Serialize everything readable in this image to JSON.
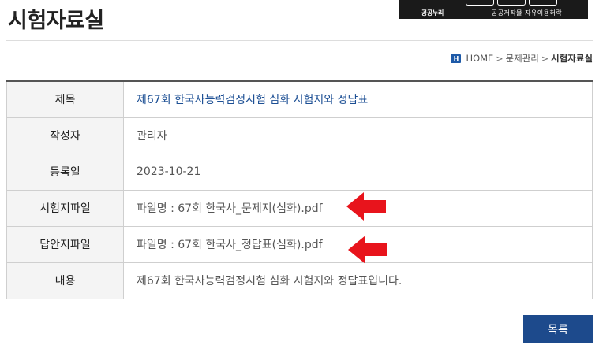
{
  "page": {
    "title": "시험자료실"
  },
  "license": {
    "left_label": "공공누리",
    "right_label": "공공저작물 자유이용허락"
  },
  "breadcrumb": {
    "home": "HOME",
    "level1": "문제관리",
    "current": "시험자료실",
    "separator": ">",
    "home_icon_glyph": "H"
  },
  "post": {
    "rows": [
      {
        "label": "제목",
        "value": "제67회 한국사능력검정시험 심화 시험지와 정답표"
      },
      {
        "label": "작성자",
        "value": "관리자"
      },
      {
        "label": "등록일",
        "value": "2023-10-21"
      },
      {
        "label": "시험지파일",
        "value": "파일명 : 67회 한국사_문제지(심화).pdf"
      },
      {
        "label": "답안지파일",
        "value": "파일명 : 67회 한국사_정답표(심화).pdf"
      },
      {
        "label": "내용",
        "value": "제67회 한국사능력검정시험 심화 시험지와 정답표입니다."
      }
    ]
  },
  "actions": {
    "list_label": "목록"
  },
  "colors": {
    "accent": "#1d4a8c",
    "title_link": "#1c4f94",
    "arrow": "#e8141c",
    "header_bg": "#f4f4f4"
  }
}
